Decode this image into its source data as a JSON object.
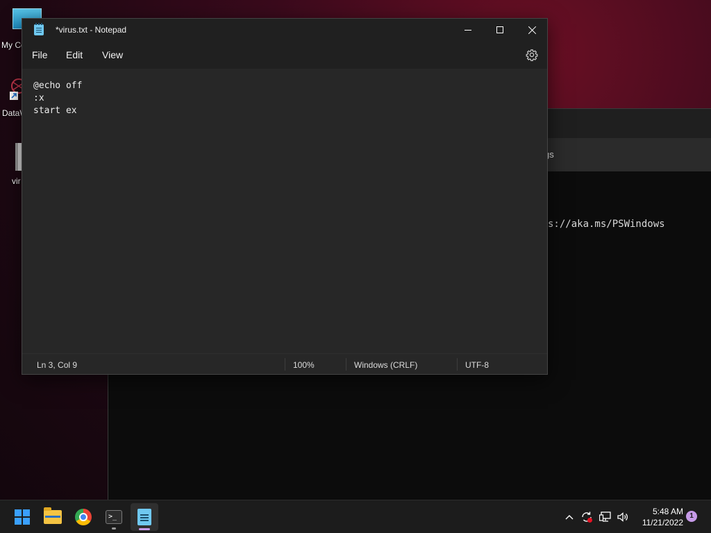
{
  "desktop": {
    "icons": [
      {
        "label": "My Co"
      },
      {
        "label": "DataW"
      },
      {
        "label": "vir"
      }
    ]
  },
  "terminal": {
    "tab_partial": "gs",
    "line_partial": "s://aka.ms/PSWindows"
  },
  "notepad": {
    "title": "*virus.txt - Notepad",
    "menu": {
      "file": "File",
      "edit": "Edit",
      "view": "View"
    },
    "content": "@echo off\n:x\nstart ex",
    "status": {
      "position": "Ln 3, Col 9",
      "zoom": "100%",
      "line_endings": "Windows (CRLF)",
      "encoding": "UTF-8"
    }
  },
  "taskbar": {
    "apps": [
      "start-icon",
      "file-explorer-icon",
      "chrome-icon",
      "terminal-icon",
      "notepad-icon"
    ],
    "clock": {
      "time": "5:48 AM",
      "date": "11/21/2022"
    },
    "notification_count": "1",
    "accent": "#c69be8"
  }
}
